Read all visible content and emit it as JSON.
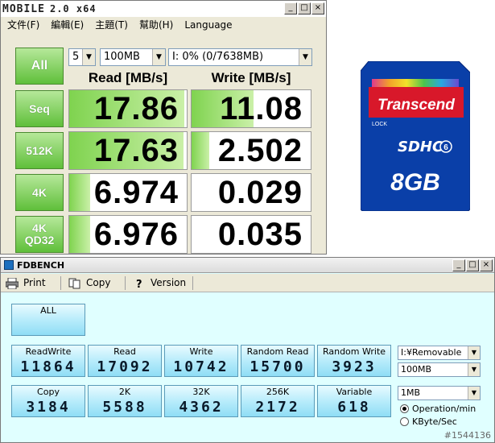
{
  "cdm": {
    "title_logo": "MOBILE",
    "title_version": "2.0 x64",
    "menu": [
      "文件(F)",
      "編輯(E)",
      "主題(T)",
      "幫助(H)",
      "Language"
    ],
    "all_button": "All",
    "count_value": "5",
    "size_value": "100MB",
    "drive_value": "I: 0% (0/7638MB)",
    "read_header": "Read [MB/s]",
    "write_header": "Write [MB/s]",
    "rows": [
      {
        "label": "Seq",
        "read": "17.86",
        "write": "11.08",
        "read_fill": 0.98,
        "write_fill": 0.52
      },
      {
        "label": "512K",
        "read": "17.63",
        "write": "2.502",
        "read_fill": 0.97,
        "write_fill": 0.15
      },
      {
        "label": "4K",
        "read": "6.974",
        "write": "0.029",
        "read_fill": 0.18,
        "write_fill": 0.0
      },
      {
        "label": "4K\nQD32",
        "label_line1": "4K",
        "label_line2": "QD32",
        "read": "6.976",
        "write": "0.035",
        "read_fill": 0.18,
        "write_fill": 0.0
      }
    ]
  },
  "sdcard": {
    "brand": "Transcend",
    "lock": "LOCK",
    "class": "6",
    "capacity": "8GB",
    "logo": "SDHC"
  },
  "fdb": {
    "title": "FDBENCH",
    "toolbar": {
      "print": "Print",
      "copy": "Copy",
      "version": "Version"
    },
    "all_button": "ALL",
    "row1": [
      {
        "label": "ReadWrite",
        "value": "11864"
      },
      {
        "label": "Read",
        "value": "17092"
      },
      {
        "label": "Write",
        "value": "10742"
      },
      {
        "label": "Random Read",
        "value": "15700"
      },
      {
        "label": "Random Write",
        "value": "3923"
      }
    ],
    "row2": [
      {
        "label": "Copy",
        "value": "3184"
      },
      {
        "label": "2K",
        "value": "5588"
      },
      {
        "label": "32K",
        "value": "4362"
      },
      {
        "label": "256K",
        "value": "2172"
      },
      {
        "label": "Variable",
        "value": "618"
      }
    ],
    "drive_select": "I:¥Removable",
    "size_select": "100MB",
    "block_select": "1MB",
    "radio_operation": "Operation/min",
    "radio_kbyte": "KByte/Sec",
    "watermark": "#1544136"
  }
}
